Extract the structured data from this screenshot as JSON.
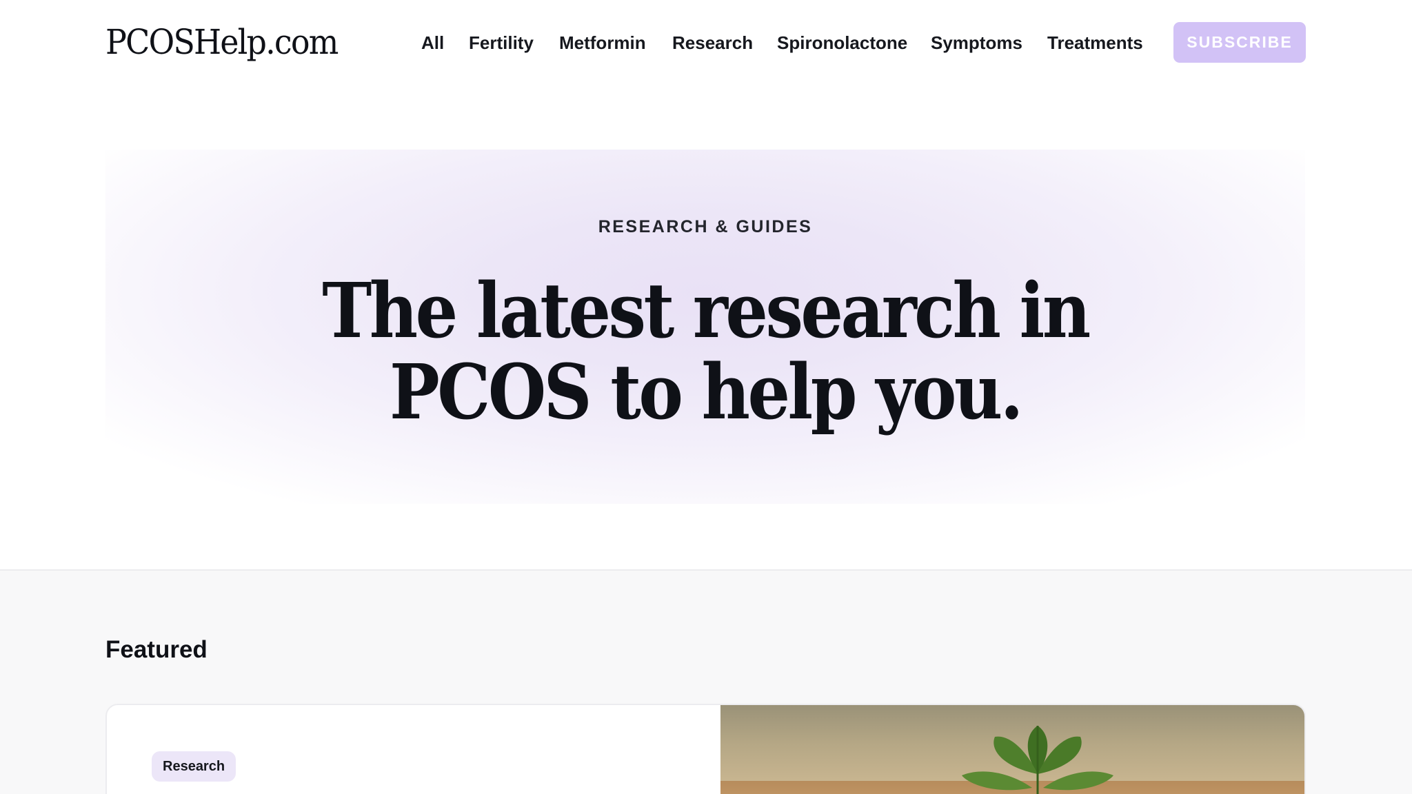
{
  "header": {
    "logo": "PCOSHelp.com",
    "nav": [
      "All",
      "Fertility",
      "Metformin",
      "Research",
      "Spironolactone",
      "Symptoms",
      "Treatments"
    ],
    "subscribe_label": "SUBSCRIBE"
  },
  "hero": {
    "eyebrow": "RESEARCH & GUIDES",
    "title_line1": "The latest research in",
    "title_line2": "PCOS to help you."
  },
  "featured": {
    "heading": "Featured",
    "card": {
      "tag": "Research",
      "image_icon": "leaf-plant-photo"
    }
  },
  "colors": {
    "accent": "#d2c2f6",
    "hero_tint": "#e9e1f6",
    "tag_bg": "#ece6f8",
    "text": "#0f1117"
  }
}
